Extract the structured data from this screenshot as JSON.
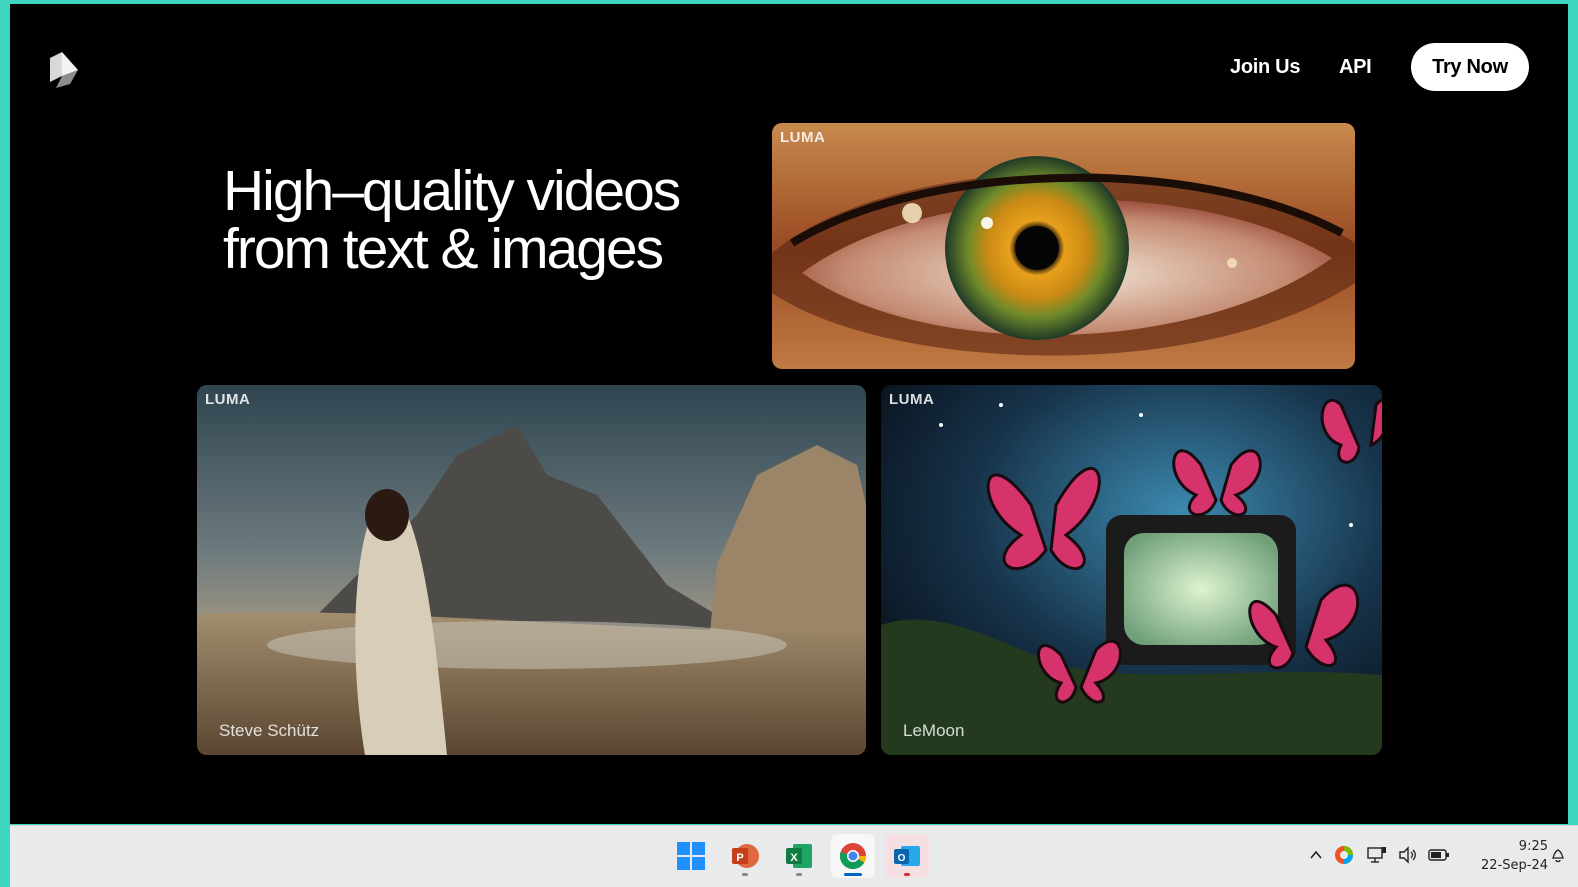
{
  "header": {
    "logo_icon": "luma-cube-logo-icon",
    "nav": [
      {
        "label": "Join Us"
      },
      {
        "label": "API"
      }
    ],
    "cta_label": "Try Now"
  },
  "hero": {
    "line1": "High–quality videos",
    "line2": "from text & images"
  },
  "videos": [
    {
      "watermark": "LUMA",
      "credit": "",
      "subject": "eye-closeup"
    },
    {
      "watermark": "LUMA",
      "credit": "Steve Schütz",
      "subject": "woman-desert-mountains"
    },
    {
      "watermark": "LUMA",
      "credit": "LeMoon",
      "subject": "butterflies-tv"
    }
  ],
  "taskbar": {
    "apps": [
      {
        "name": "windows-start-icon"
      },
      {
        "name": "powerpoint-icon"
      },
      {
        "name": "excel-icon"
      },
      {
        "name": "chrome-icon"
      },
      {
        "name": "outlook-icon"
      }
    ],
    "tray": [
      "chevron-up-icon",
      "copilot-icon",
      "network-icon",
      "volume-icon",
      "battery-icon"
    ],
    "time": "9:25",
    "date": "22-Sep-24"
  }
}
